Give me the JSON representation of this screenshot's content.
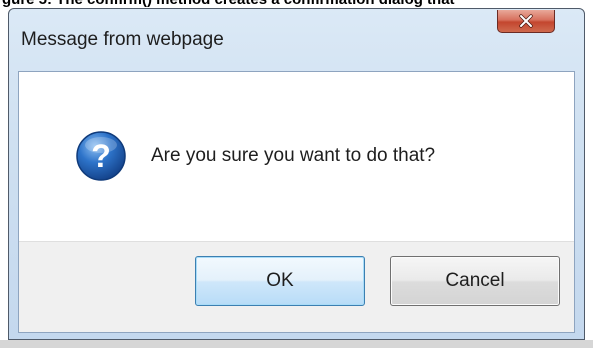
{
  "background": {
    "partial_heading": "gure 5: The confirm() method creates a confirmation dialog that"
  },
  "dialog": {
    "title": "Message from webpage",
    "message": "Are you sure you want to do that?",
    "icon": "question-icon",
    "close_icon": "close-icon",
    "ok_label": "OK",
    "cancel_label": "Cancel"
  },
  "colors": {
    "close_button": "#c3462f",
    "ok_border": "#3c7fb1",
    "icon_blue": "#1d5fb0"
  }
}
